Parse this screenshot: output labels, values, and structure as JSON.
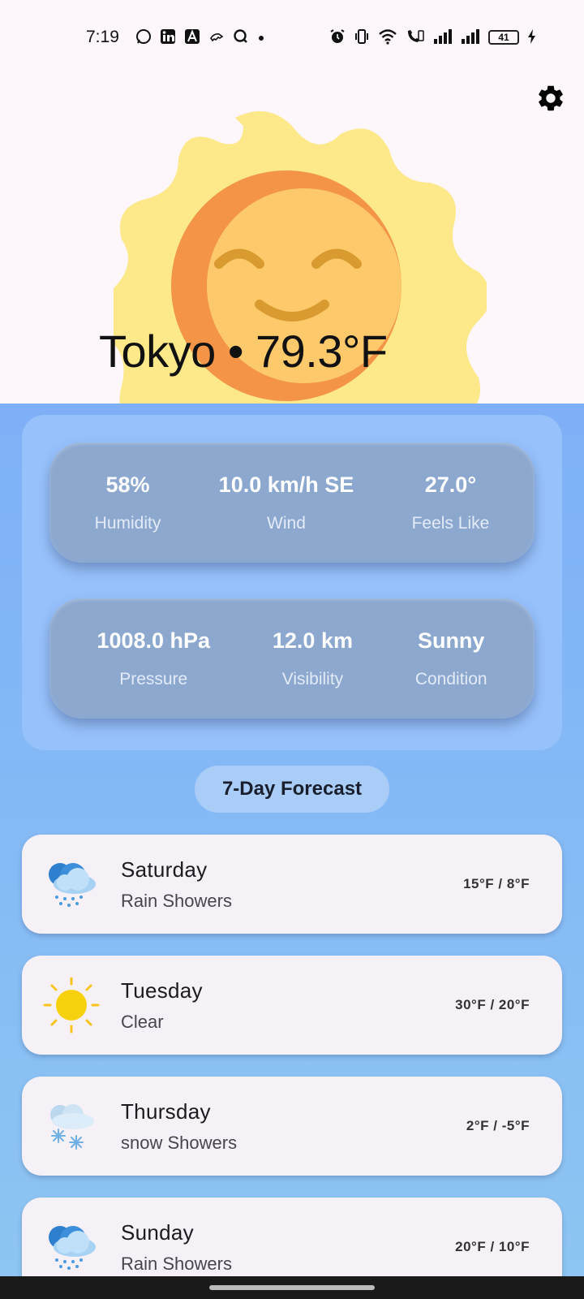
{
  "status_bar": {
    "time": "7:19",
    "notification_icons": [
      "whatsapp-icon",
      "linkedin-icon",
      "app-a-icon",
      "tool-icon",
      "search-q-icon",
      "dot-icon"
    ],
    "system_icons": [
      "alarm-icon",
      "vibrate-icon",
      "wifi-icon",
      "volte-call-icon",
      "signal-icon",
      "signal-icon"
    ],
    "battery": "41"
  },
  "header": {
    "city_temp": "Tokyo • 79.3°F"
  },
  "details": {
    "row1": [
      {
        "value": "58%",
        "label": "Humidity"
      },
      {
        "value": "10.0 km/h SE",
        "label": "Wind"
      },
      {
        "value": "27.0°",
        "label": "Feels Like"
      }
    ],
    "row2": [
      {
        "value": "1008.0 hPa",
        "label": "Pressure"
      },
      {
        "value": "12.0 km",
        "label": "Visibility"
      },
      {
        "value": "Sunny",
        "label": "Condition"
      }
    ]
  },
  "forecast": {
    "title": "7-Day Forecast",
    "days": [
      {
        "day": "Saturday",
        "condition": "Rain Showers",
        "temp": "15°F / 8°F",
        "icon": "rain-showers-icon"
      },
      {
        "day": "Tuesday",
        "condition": "Clear",
        "temp": "30°F / 20°F",
        "icon": "sun-icon"
      },
      {
        "day": "Thursday",
        "condition": "snow Showers",
        "temp": "2°F / -5°F",
        "icon": "snow-showers-icon"
      },
      {
        "day": "Sunday",
        "condition": "Rain Showers",
        "temp": "20°F / 10°F",
        "icon": "rain-showers-icon"
      }
    ]
  },
  "colors": {
    "header_bg": "#fdf6fb",
    "main_gradient_top": "#7fb0f7",
    "panel_bg": "#97c1fb",
    "stat_card_bg": "#8ca8cf",
    "day_card_bg": "#f6f0f7",
    "sun_outer": "#fde98a",
    "sun_face": "#fdc96b",
    "sun_shadow": "#f39447"
  }
}
